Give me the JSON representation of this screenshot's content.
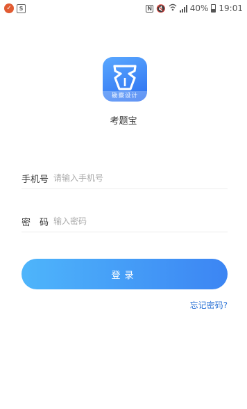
{
  "status_bar": {
    "badge_icon": "check-badge-icon",
    "app_icon": "s-app-icon",
    "battery": "40%",
    "time": "19:01"
  },
  "app": {
    "logo_label": "勘察设计",
    "name": "考题宝"
  },
  "form": {
    "phone_label": "手机号",
    "phone_placeholder": "请输入手机号",
    "password_label": "密　码",
    "password_placeholder": "输入密码"
  },
  "actions": {
    "login_label": "登录",
    "forgot_label": "忘记密码?"
  },
  "colors": {
    "primary_start": "#4eb5fb",
    "primary_end": "#3c85f3",
    "link": "#2d74d6"
  }
}
